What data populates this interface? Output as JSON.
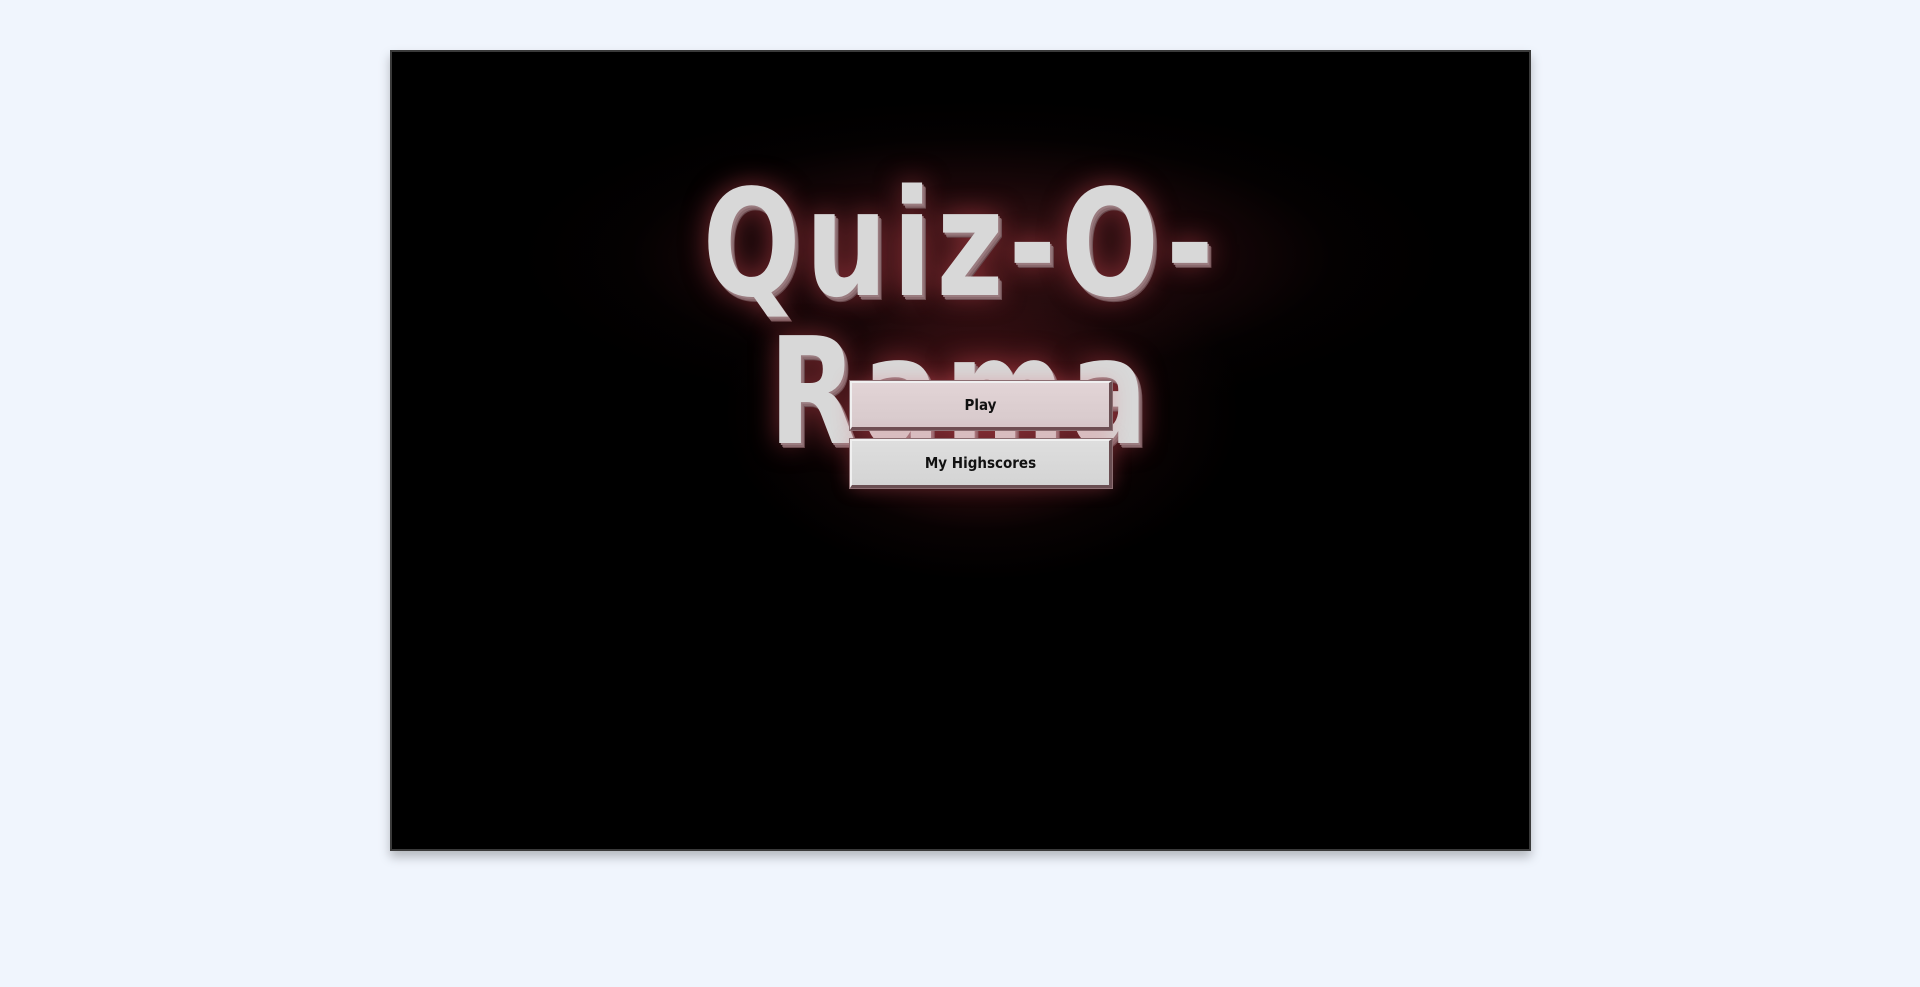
{
  "game": {
    "title": "Quiz-O-Rama",
    "menu": {
      "play_label": "Play",
      "highscores_label": "My Highscores"
    }
  },
  "colors": {
    "page_background": "#f0f5fd",
    "game_background": "#000000",
    "glow": "#8c2d32",
    "title_text": "#d8d8d8",
    "button_face": "#d8d8d8"
  }
}
